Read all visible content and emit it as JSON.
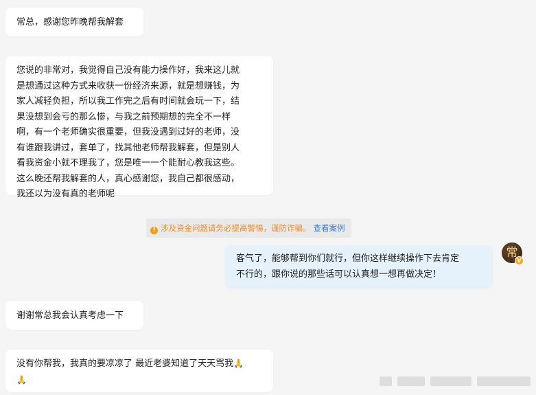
{
  "messages": [
    {
      "side": "left",
      "text": "常总，感谢您昨晚帮我解套"
    },
    {
      "side": "left",
      "lines": [
        "您说的非常对，我觉得自己没有能力操作好，我来这儿就",
        "是想通过这种方式来收获一份经济来源，就是想赚钱，为",
        "家人减轻负担，所以我工作完之后有时间就会玩一下，结",
        "果没想到会亏的那么惨，与我之前预期想的完全不一样",
        "啊，有一个老师确实很重要，但我没遇到过好的老师，没",
        "有谁跟我讲过，套单了，找其他老师帮我解套，但是别人",
        "看我资金小就不理我了，您是唯一一个能耐心教我这些。",
        "这么晚还帮我解套的人，真心感谢您，我自己都很感动，",
        "我还以为没有真的老师呢"
      ]
    },
    {
      "side": "right",
      "lines": [
        "客气了，能够帮到你们就行，但你这样继续操作下去肯定",
        "不行的，跟你说的那些话可以认真想一想再做决定！"
      ]
    },
    {
      "side": "left",
      "text": "谢谢常总我会认真考虑一下"
    },
    {
      "side": "left",
      "lines": [
        "没有你帮我，我真的要凉凉了 最近老婆知道了天天骂我",
        ""
      ],
      "emoji": "🙏"
    }
  ],
  "notice": {
    "icon": "warning-icon",
    "text": "涉及资金问题请务必提高警惕，谨防诈骗。",
    "link": "查看案例"
  },
  "avatar": {
    "char": "常",
    "badge": "V"
  },
  "colors": {
    "background": "#f5f5f5",
    "bubble_left": "#ffffff",
    "bubble_right": "#e6f2fb",
    "warning": "#f08a2a",
    "link": "#3b7bd4"
  }
}
